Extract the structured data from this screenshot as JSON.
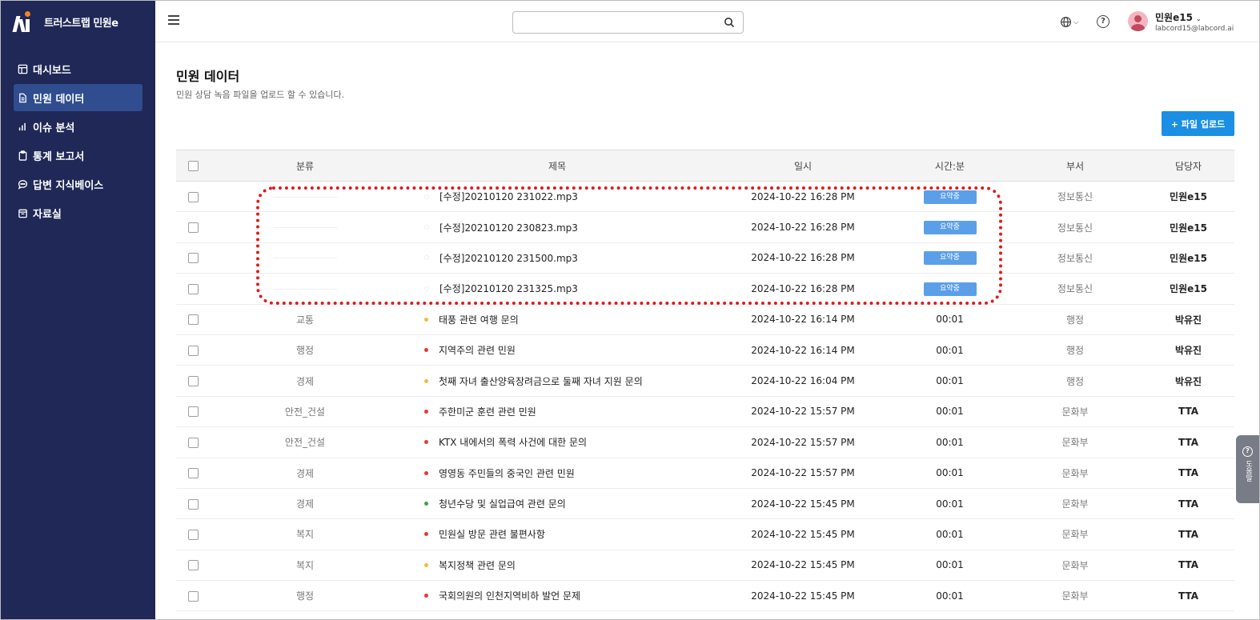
{
  "app": {
    "brand": "트러스트랩 민원e"
  },
  "sidebar": {
    "items": [
      {
        "label": "대시보드",
        "icon": "dashboard-icon"
      },
      {
        "label": "민원 데이터",
        "icon": "document-icon",
        "active": true
      },
      {
        "label": "이슈 분석",
        "icon": "bar-chart-icon"
      },
      {
        "label": "통계 보고서",
        "icon": "clipboard-icon"
      },
      {
        "label": "답변 지식베이스",
        "icon": "chat-icon"
      },
      {
        "label": "자료실",
        "icon": "archive-icon"
      }
    ]
  },
  "header": {
    "search_placeholder": "",
    "user": {
      "name": "민원e15",
      "email": "labcord15@labcord.ai"
    }
  },
  "page": {
    "title": "민원 데이터",
    "subtitle": "민원 상담 녹음 파일을 업로드 할 수 있습니다.",
    "upload_label": "+ 파일 업로드"
  },
  "table": {
    "headers": {
      "category": "분류",
      "title": "제목",
      "datetime": "일시",
      "duration": "시간:분",
      "dept": "부서",
      "owner": "담당자"
    },
    "rows": [
      {
        "category": "",
        "dot": "empty",
        "title": "[수정]20210120 231022.mp3",
        "datetime": "2024-10-22 16:28 PM",
        "duration": "요약중",
        "badge": true,
        "dept": "정보통신",
        "owner": "민원e15"
      },
      {
        "category": "",
        "dot": "empty",
        "title": "[수정]20210120 230823.mp3",
        "datetime": "2024-10-22 16:28 PM",
        "duration": "요약중",
        "badge": true,
        "dept": "정보통신",
        "owner": "민원e15"
      },
      {
        "category": "",
        "dot": "empty",
        "title": "[수정]20210120 231500.mp3",
        "datetime": "2024-10-22 16:28 PM",
        "duration": "요약중",
        "badge": true,
        "dept": "정보통신",
        "owner": "민원e15"
      },
      {
        "category": "",
        "dot": "empty",
        "title": "[수정]20210120 231325.mp3",
        "datetime": "2024-10-22 16:28 PM",
        "duration": "요약중",
        "badge": true,
        "dept": "정보통신",
        "owner": "민원e15"
      },
      {
        "category": "교통",
        "dot": "orange",
        "title": "태풍 관련 여행 문의",
        "datetime": "2024-10-22 16:14 PM",
        "duration": "00:01",
        "badge": false,
        "dept": "행정",
        "owner": "박유진"
      },
      {
        "category": "행정",
        "dot": "red",
        "title": "지역주의 관련 민원",
        "datetime": "2024-10-22 16:14 PM",
        "duration": "00:01",
        "badge": false,
        "dept": "행정",
        "owner": "박유진"
      },
      {
        "category": "경제",
        "dot": "orange",
        "title": "첫째 자녀 출산양육장려금으로 둘째 자녀 지원 문의",
        "datetime": "2024-10-22 16:04 PM",
        "duration": "00:01",
        "badge": false,
        "dept": "행정",
        "owner": "박유진"
      },
      {
        "category": "안전_건설",
        "dot": "red",
        "title": "주한미군 훈련 관련 민원",
        "datetime": "2024-10-22 15:57 PM",
        "duration": "00:01",
        "badge": false,
        "dept": "문화부",
        "owner": "TTA"
      },
      {
        "category": "안전_건설",
        "dot": "red",
        "title": "KTX 내에서의 폭력 사건에 대한 문의",
        "datetime": "2024-10-22 15:57 PM",
        "duration": "00:01",
        "badge": false,
        "dept": "문화부",
        "owner": "TTA"
      },
      {
        "category": "경제",
        "dot": "red",
        "title": "영영동 주민들의 중국인 관련 민원",
        "datetime": "2024-10-22 15:57 PM",
        "duration": "00:01",
        "badge": false,
        "dept": "문화부",
        "owner": "TTA"
      },
      {
        "category": "경제",
        "dot": "green",
        "title": "청년수당 및 실업급여 관련 문의",
        "datetime": "2024-10-22 15:45 PM",
        "duration": "00:01",
        "badge": false,
        "dept": "문화부",
        "owner": "TTA"
      },
      {
        "category": "복지",
        "dot": "red",
        "title": "민원실 방문 관련 불편사항",
        "datetime": "2024-10-22 15:45 PM",
        "duration": "00:01",
        "badge": false,
        "dept": "문화부",
        "owner": "TTA"
      },
      {
        "category": "복지",
        "dot": "orange",
        "title": "복지정책 관련 문의",
        "datetime": "2024-10-22 15:45 PM",
        "duration": "00:01",
        "badge": false,
        "dept": "문화부",
        "owner": "TTA"
      },
      {
        "category": "행정",
        "dot": "red",
        "title": "국회의원의 인천지역비하 발언 문제",
        "datetime": "2024-10-22 15:45 PM",
        "duration": "00:01",
        "badge": false,
        "dept": "문화부",
        "owner": "TTA"
      }
    ]
  },
  "help_tab": {
    "label": "도움말"
  },
  "colors": {
    "sidebar_bg": "#1f2856",
    "sidebar_active": "#2f4d8f",
    "accent": "#1a8fe3",
    "badge": "#5b9fe8",
    "highlight": "#e01b1b"
  }
}
